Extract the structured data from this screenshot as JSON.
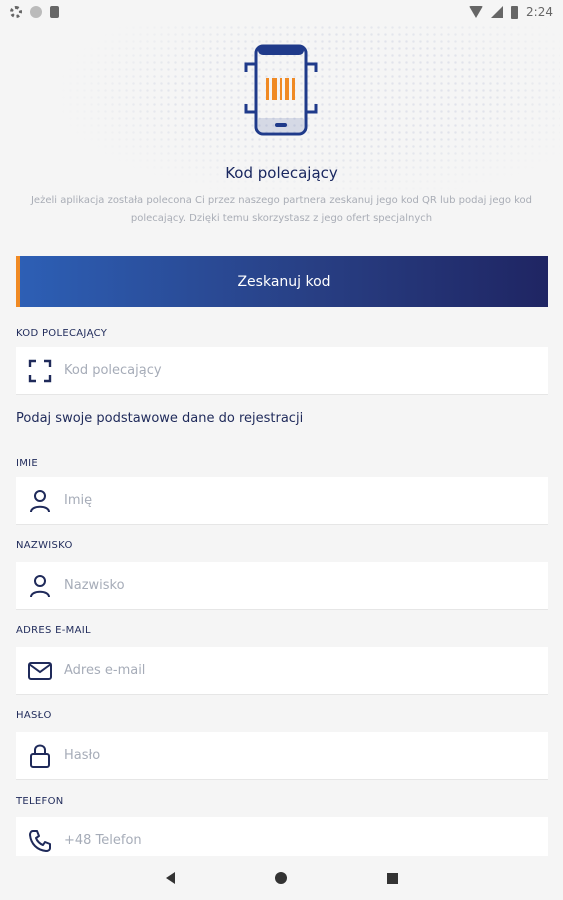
{
  "status_bar": {
    "time": "2:24"
  },
  "header": {
    "title": "Kod polecający",
    "description": "Jeżeli aplikacja została polecona Ci przez naszego partnera zeskanuj jego kod QR lub podaj jego kod polecający. Dzięki temu skorzystasz z jego ofert specjalnych"
  },
  "scan_button": {
    "label": "Zeskanuj kod"
  },
  "referral": {
    "label": "KOD POLECAJĄCY",
    "placeholder": "Kod polecający",
    "value": ""
  },
  "section_heading": "Podaj swoje podstawowe dane do rejestracji",
  "fields": {
    "first_name": {
      "label": "IMIE",
      "placeholder": "Imię",
      "icon": "person-icon"
    },
    "last_name": {
      "label": "NAZWISKO",
      "placeholder": "Nazwisko",
      "icon": "person-icon"
    },
    "email": {
      "label": "ADRES E-MAIL",
      "placeholder": "Adres e-mail",
      "icon": "envelope-icon"
    },
    "password": {
      "label": "HASŁO",
      "placeholder": "Hasło",
      "icon": "lock-icon"
    },
    "phone": {
      "label": "TELEFON",
      "placeholder": "+48 Telefon",
      "icon": "phone-icon"
    }
  },
  "colors": {
    "accent": "#f08a24",
    "primary": "#1f2a5a",
    "gradient_start": "#2d5fb5",
    "gradient_end": "#1f2563"
  }
}
